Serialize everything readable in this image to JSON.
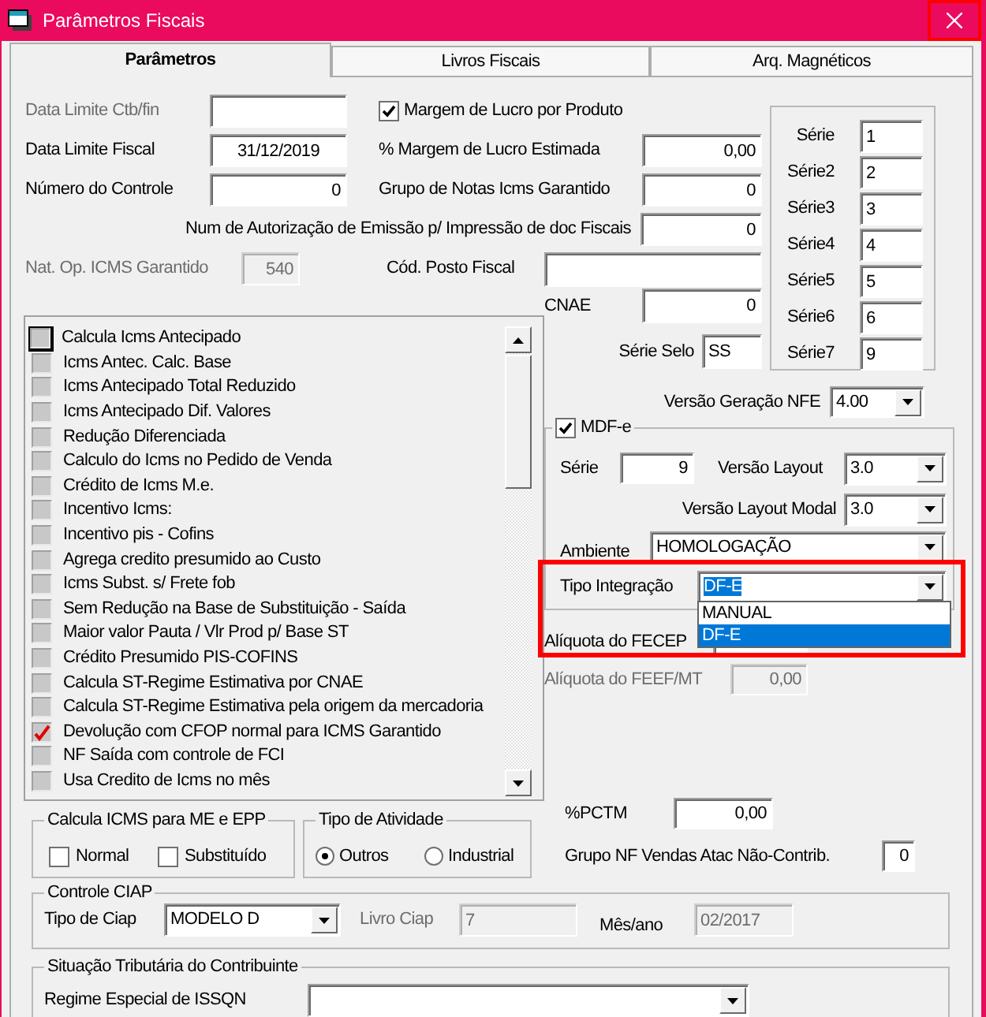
{
  "window": {
    "title": "Parâmetros Fiscais",
    "close_highlighted": true
  },
  "tabs": [
    {
      "label": "Parâmetros",
      "selected": true
    },
    {
      "label": "Livros Fiscais",
      "selected": false
    },
    {
      "label": "Arq. Magnéticos",
      "selected": false
    }
  ],
  "data_limite_ctb": {
    "label": "Data Limite Ctb/fin",
    "label_disabled": true
  },
  "margem_por_produto": {
    "label": "Margem de Lucro por Produto",
    "checked": true
  },
  "data_limite_fiscal": {
    "label": "Data Limite Fiscal",
    "value": "31/12/2019"
  },
  "margem_estimada": {
    "label": "% Margem de Lucro Estimada",
    "value": "0,00"
  },
  "numero_controle": {
    "label": "Número do Controle",
    "value": "0"
  },
  "grupo_notas": {
    "label": "Grupo de Notas Icms Garantido",
    "value": "0"
  },
  "num_autorizacao": {
    "label": "Num de Autorização de Emissão p/ Impressão de doc Fiscais",
    "value": "0"
  },
  "nat_op": {
    "label": "Nat. Op. ICMS Garantido",
    "label_disabled": true,
    "value": "540",
    "disabled": true
  },
  "posto_fiscal": {
    "label": "Cód. Posto Fiscal"
  },
  "series": [
    {
      "label": "Série",
      "value": "1"
    },
    {
      "label": "Série2",
      "value": "2"
    },
    {
      "label": "Série3",
      "value": "3"
    },
    {
      "label": "Série4",
      "value": "4"
    },
    {
      "label": "Série5",
      "value": "5"
    },
    {
      "label": "Série6",
      "value": "6"
    },
    {
      "label": "Série7",
      "value": "9"
    }
  ],
  "cnae": {
    "label": "CNAE",
    "value": "0"
  },
  "serie_selo": {
    "label": "Série Selo",
    "value": "SS"
  },
  "options": [
    {
      "label": "Calcula Icms Antecipado",
      "checked": false,
      "focused": true
    },
    {
      "label": "Icms Antec. Calc. Base",
      "checked": false,
      "focused": false
    },
    {
      "label": "Icms Antecipado Total Reduzido",
      "checked": false,
      "focused": false
    },
    {
      "label": "Icms Antecipado Dif. Valores",
      "checked": false,
      "focused": false
    },
    {
      "label": "Redução Diferenciada",
      "checked": false,
      "focused": false
    },
    {
      "label": "Calculo do Icms no Pedido de Venda",
      "checked": false,
      "focused": false
    },
    {
      "label": "Crédito de Icms M.e.",
      "checked": false,
      "focused": false
    },
    {
      "label": "Incentivo Icms:",
      "checked": false,
      "focused": false
    },
    {
      "label": "Incentivo pis - Cofins",
      "checked": false,
      "focused": false
    },
    {
      "label": "Agrega credito presumido ao Custo",
      "checked": false,
      "focused": false
    },
    {
      "label": "Icms Subst. s/ Frete fob",
      "checked": false,
      "focused": false
    },
    {
      "label": "Sem Redução na Base de Substituição - Saída",
      "checked": false,
      "focused": false
    },
    {
      "label": "Maior valor Pauta / Vlr Prod p/ Base ST",
      "checked": false,
      "focused": false
    },
    {
      "label": "Crédito Presumido PIS-COFINS",
      "checked": false,
      "focused": false
    },
    {
      "label": "Calcula ST-Regime Estimativa por CNAE",
      "checked": false,
      "focused": false
    },
    {
      "label": "Calcula ST-Regime Estimativa pela origem da mercadoria",
      "checked": false,
      "focused": false
    },
    {
      "label": "Devolução com CFOP normal para ICMS Garantido",
      "checked": true,
      "focused": false
    },
    {
      "label": "NF Saída com controle de FCI",
      "checked": false,
      "focused": false
    },
    {
      "label": "Usa Credito de Icms no mês",
      "checked": false,
      "focused": false
    }
  ],
  "versao_nfe": {
    "label": "Versão Geração NFE",
    "value": "4.00"
  },
  "mdfe": {
    "label": "MDF-e",
    "checked": true,
    "serie": {
      "label": "Série",
      "value": "9"
    },
    "versao_layout": {
      "label": "Versão Layout",
      "value": "3.0"
    },
    "versao_layout_modal": {
      "label": "Versão Layout Modal",
      "value": "3.0"
    },
    "ambiente": {
      "label": "Ambiente",
      "value": "HOMOLOGAÇÃO"
    },
    "tipo_integracao": {
      "label": "Tipo Integração",
      "value": "DF-E",
      "highlighted": true,
      "open": true,
      "options": [
        {
          "label": "MANUAL",
          "selected": false
        },
        {
          "label": "DF-E",
          "selected": true
        }
      ]
    }
  },
  "aliquota_fecep": {
    "label": "Alíquota do FECEP"
  },
  "aliquota_feef": {
    "label": "Alíquota do FEEF/MT",
    "label_disabled": true,
    "value": "0,00",
    "disabled": true
  },
  "calcula_icms_me_epp": {
    "title": "Calcula ICMS para ME e EPP",
    "options": [
      {
        "label": "Normal",
        "checked": false
      },
      {
        "label": "Substituído",
        "checked": false
      }
    ]
  },
  "tipo_atividade": {
    "title": "Tipo de Atividade",
    "options": [
      {
        "label": "Outros",
        "selected": true
      },
      {
        "label": "Industrial",
        "selected": false
      }
    ]
  },
  "pctm": {
    "label": "%PCTM",
    "value": "0,00"
  },
  "grupo_nf_vendas": {
    "label": "Grupo NF Vendas Atac Não-Contrib.",
    "value": "0"
  },
  "controle_ciap": {
    "title": "Controle CIAP",
    "tipo": {
      "label": "Tipo de Ciap",
      "value": "MODELO D"
    },
    "livro": {
      "label": "Livro Ciap",
      "label_disabled": true,
      "value": "7",
      "disabled": true
    },
    "mes_ano": {
      "label": "Mês/ano",
      "value": "02/2017",
      "disabled": true
    }
  },
  "situacao_tributaria": {
    "title": "Situação Tributária do Contribuinte",
    "regime_issqn": {
      "label": "Regime Especial de ISSQN"
    }
  }
}
